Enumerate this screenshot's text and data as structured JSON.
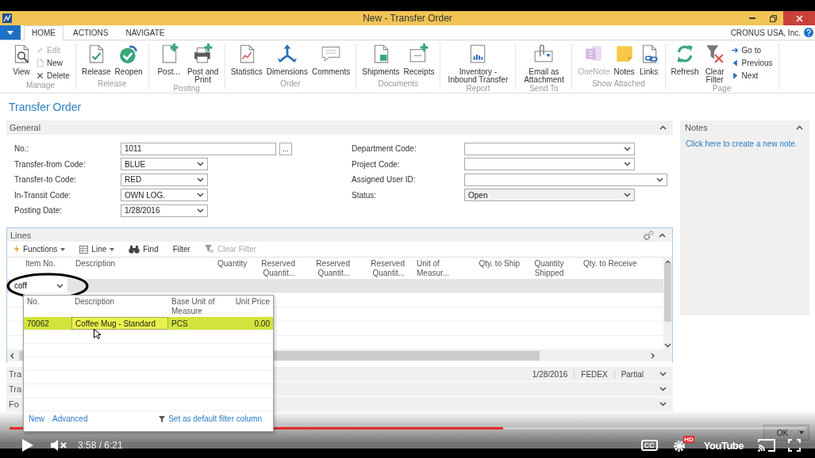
{
  "window": {
    "title": "New - Transfer Order"
  },
  "ribbon": {
    "tabs": [
      {
        "label": "HOME",
        "selected": true
      },
      {
        "label": "ACTIONS",
        "selected": false
      },
      {
        "label": "NAVIGATE",
        "selected": false
      }
    ],
    "company": "CRONUS USA, Inc.",
    "groups": [
      {
        "label": "Manage",
        "buttons": [
          {
            "label": "View",
            "kind": "large",
            "disabled": false
          },
          {
            "label": "Edit",
            "kind": "small",
            "disabled": true
          },
          {
            "label": "New",
            "kind": "small",
            "disabled": false
          },
          {
            "label": "Delete",
            "kind": "small",
            "disabled": false
          }
        ]
      },
      {
        "label": "Release",
        "buttons": [
          {
            "label": "Release",
            "kind": "large",
            "disabled": false
          },
          {
            "label": "Reopen",
            "kind": "large",
            "disabled": false
          }
        ]
      },
      {
        "label": "Posting",
        "buttons": [
          {
            "label": "Post...",
            "kind": "large",
            "disabled": false
          },
          {
            "label": "Post and Print",
            "kind": "large",
            "disabled": false
          }
        ]
      },
      {
        "label": "Order",
        "buttons": [
          {
            "label": "Statistics",
            "kind": "large",
            "disabled": false
          },
          {
            "label": "Dimensions",
            "kind": "large",
            "disabled": false
          },
          {
            "label": "Comments",
            "kind": "large",
            "disabled": false
          }
        ]
      },
      {
        "label": "Documents",
        "buttons": [
          {
            "label": "Shipments",
            "kind": "large",
            "disabled": false
          },
          {
            "label": "Receipts",
            "kind": "large",
            "disabled": false
          }
        ]
      },
      {
        "label": "Report",
        "buttons": [
          {
            "label": "Inventory - Inbound Transfer",
            "kind": "large",
            "disabled": false
          }
        ]
      },
      {
        "label": "Send To",
        "buttons": [
          {
            "label": "Email as Attachment",
            "kind": "large",
            "disabled": false
          }
        ]
      },
      {
        "label": "Show Attached",
        "buttons": [
          {
            "label": "OneNote",
            "kind": "large",
            "disabled": true
          },
          {
            "label": "Notes",
            "kind": "large",
            "disabled": false
          },
          {
            "label": "Links",
            "kind": "large",
            "disabled": false
          }
        ]
      },
      {
        "label": "Page",
        "buttons": [
          {
            "label": "Refresh",
            "kind": "large",
            "disabled": false
          },
          {
            "label": "Clear Filter",
            "kind": "large",
            "disabled": false
          },
          {
            "label": "Go to",
            "kind": "small",
            "disabled": false
          },
          {
            "label": "Previous",
            "kind": "small",
            "disabled": false
          },
          {
            "label": "Next",
            "kind": "small",
            "disabled": false
          }
        ]
      }
    ]
  },
  "page_title": "Transfer Order",
  "general": {
    "title": "General",
    "expanded": true,
    "left_fields": [
      {
        "label": "No.:",
        "value": "1011",
        "kind": "lookup",
        "assist": "...",
        "disabled": false
      },
      {
        "label": "Transfer-from Code:",
        "value": "BLUE",
        "kind": "dropdown",
        "disabled": false
      },
      {
        "label": "Transfer-to Code:",
        "value": "RED",
        "kind": "dropdown",
        "disabled": false
      },
      {
        "label": "In-Transit Code:",
        "value": "OWN LOG.",
        "kind": "dropdown",
        "disabled": false
      },
      {
        "label": "Posting Date:",
        "value": "1/28/2016",
        "kind": "dropdown",
        "disabled": false
      }
    ],
    "right_fields": [
      {
        "label": "Department Code:",
        "kind": "dropdown",
        "disabled": false
      },
      {
        "label": "Project Code:",
        "kind": "dropdown",
        "disabled": false
      },
      {
        "label": "Assigned User ID:",
        "kind": "dropdown",
        "disabled": false
      },
      {
        "label": "Status:",
        "value": "Open",
        "kind": "dropdown",
        "disabled": true
      }
    ]
  },
  "notes": {
    "title": "Notes",
    "expanded": true,
    "link": "Click here to create a new note."
  },
  "lines": {
    "title": "Lines",
    "expanded": true,
    "toolbar": [
      {
        "label": "Functions",
        "menu": true,
        "disabled": false
      },
      {
        "label": "Line",
        "menu": true,
        "disabled": false
      },
      {
        "label": "Find",
        "menu": false,
        "disabled": false
      },
      {
        "label": "Filter",
        "menu": false,
        "disabled": false
      },
      {
        "label": "Clear Filter",
        "menu": false,
        "disabled": true
      }
    ],
    "columns": [
      "Item No.",
      "Description",
      "Quantity",
      "Reserved Quantit...",
      "Reserved Quantit...",
      "Reserved Quantit...",
      "Unit of Measur...",
      "Qty. to Ship",
      "Quantity Shipped",
      "Qty. to Receive"
    ],
    "rows": [
      {
        "selected": true,
        "item_no": "coff"
      },
      {
        "selected": false
      },
      {
        "selected": false
      },
      {
        "selected": false
      },
      {
        "selected": false
      }
    ],
    "lookup": {
      "columns": [
        "No.",
        "Description",
        "Base Unit of Measure",
        "Unit Price"
      ],
      "rows": [
        {
          "selected": true,
          "cells": [
            "70062",
            "Coffee Mug - Standard",
            "PCS",
            "0.00"
          ]
        }
      ],
      "footer_links": [
        "New",
        "Advanced"
      ],
      "footer_action": "Set as default filter column"
    }
  },
  "fasttabs": [
    {
      "label": "Tra",
      "expanded": false,
      "summary": [
        "1/28/2016",
        "FEDEX",
        "Partial"
      ]
    },
    {
      "label": "Tra",
      "expanded": false
    },
    {
      "label": "Fo",
      "expanded": false
    }
  ],
  "dialog_buttons": [
    {
      "label": "OK"
    }
  ],
  "video": {
    "playing": false,
    "muted": true,
    "progress": {
      "level": 0.62
    },
    "time": "3:58 / 6:21",
    "captions": "CC",
    "quality_badge": "HD",
    "logo": "YouTube"
  }
}
